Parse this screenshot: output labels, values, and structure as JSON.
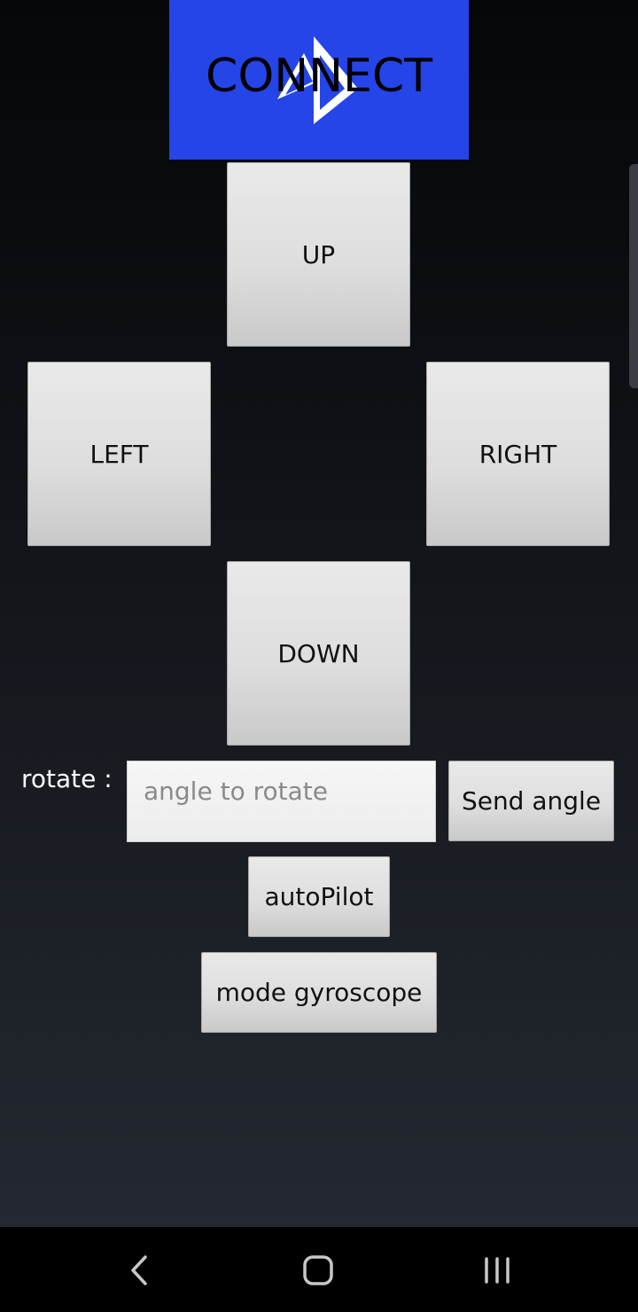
{
  "connect": {
    "label": "CONNECT",
    "background": "#2545e8",
    "logo_icon": "play-logo-icon"
  },
  "dpad": {
    "up": "UP",
    "left": "LEFT",
    "right": "RIGHT",
    "down": "DOWN"
  },
  "rotate": {
    "label": "rotate :",
    "input_value": "",
    "input_placeholder": "angle to rotate",
    "send_label": "Send angle"
  },
  "autopilot": {
    "label": "autoPilot"
  },
  "gyroscope": {
    "label": "mode gyroscope"
  },
  "navbar": {
    "icons": [
      "back-icon",
      "home-icon",
      "recents-icon"
    ]
  },
  "colors": {
    "accent": "#2545e8",
    "button_face": "#dedede",
    "background_top": "#05070a",
    "background_bottom": "#262a33"
  }
}
